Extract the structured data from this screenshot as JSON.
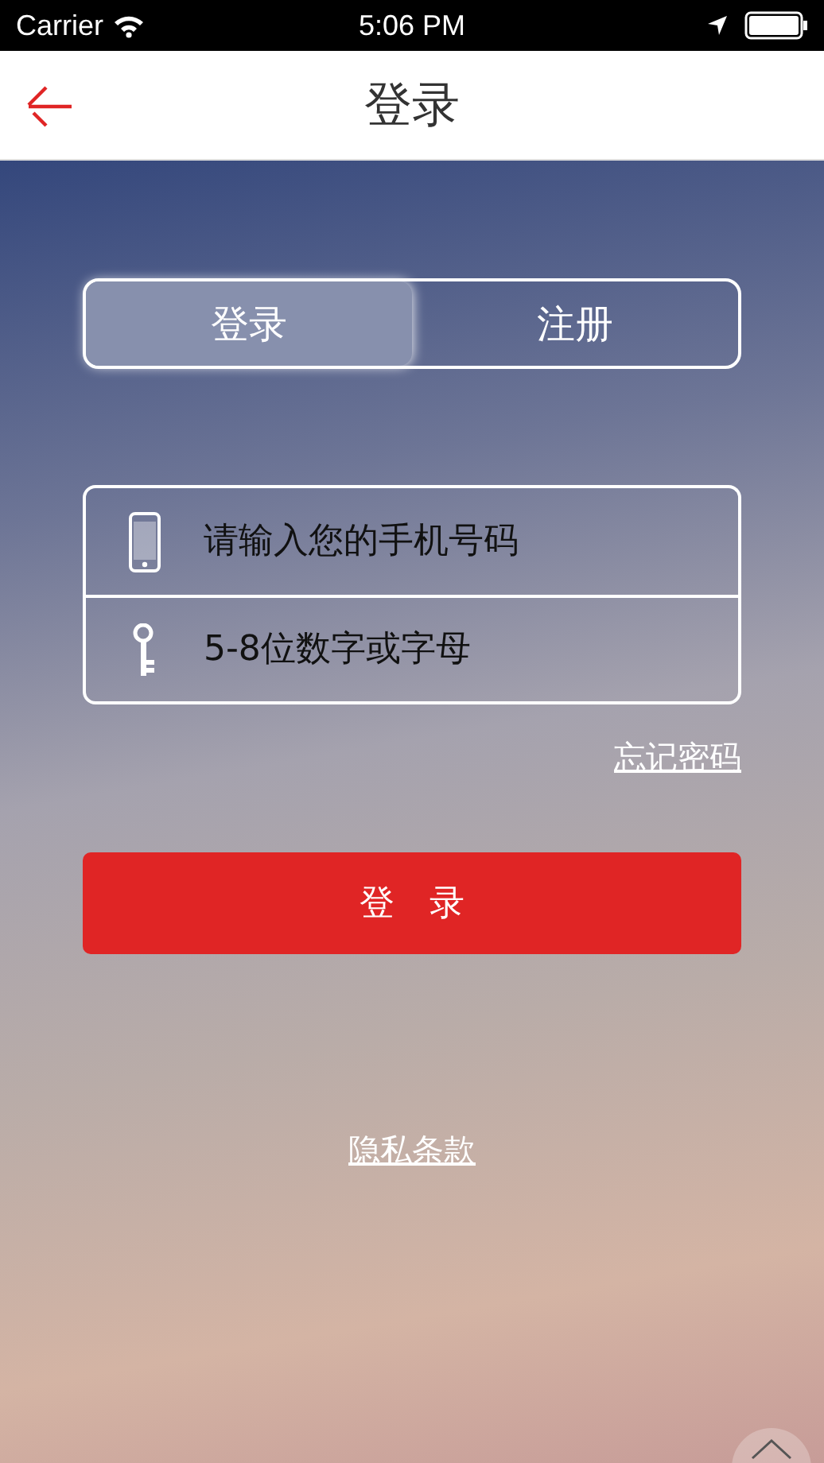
{
  "status_bar": {
    "carrier": "Carrier",
    "time": "5:06 PM"
  },
  "nav": {
    "title": "登录"
  },
  "tabs": [
    {
      "label": "登录",
      "selected": true
    },
    {
      "label": "注册",
      "selected": false
    }
  ],
  "fields": [
    {
      "kind": "phone",
      "placeholder": "请输入您的手机号码"
    },
    {
      "kind": "password",
      "placeholder": "5-8位数字或字母"
    }
  ],
  "forgot_link": "忘记密码",
  "login_button": "登　录",
  "privacy_link": "隐私条款"
}
